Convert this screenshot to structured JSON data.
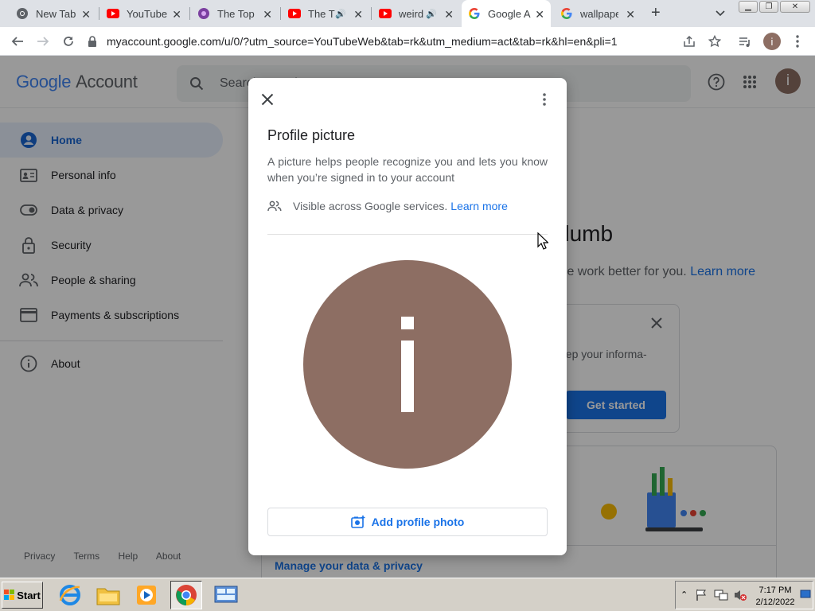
{
  "browser": {
    "tabs": [
      {
        "title": "New Tab",
        "favicon": "chrome-icon"
      },
      {
        "title": "YouTube",
        "favicon": "youtube-icon"
      },
      {
        "title": "The Top",
        "favicon": "flower-icon"
      },
      {
        "title": "The T",
        "favicon": "youtube-icon",
        "audio": true
      },
      {
        "title": "weird",
        "favicon": "youtube-icon",
        "audio": true
      },
      {
        "title": "Google A",
        "favicon": "google-icon",
        "active": true
      },
      {
        "title": "wallpape",
        "favicon": "google-icon"
      }
    ],
    "new_tab_label": "+",
    "url": "myaccount.google.com/u/0/?utm_source=YouTubeWeb&tab=rk&utm_medium=act&tab=rk&hl=en&pli=1",
    "profile_initial": "i"
  },
  "page": {
    "logo_google": "Google",
    "logo_account": "Account",
    "search_placeholder": "Search Google Account",
    "avatar_initial": "i",
    "nav": [
      {
        "label": "Home",
        "icon": "person-circle-icon",
        "selected": true
      },
      {
        "label": "Personal info",
        "icon": "id-card-icon"
      },
      {
        "label": "Data & privacy",
        "icon": "toggle-icon"
      },
      {
        "label": "Security",
        "icon": "lock-icon"
      },
      {
        "label": "People & sharing",
        "icon": "people-icon"
      },
      {
        "label": "Payments & subscriptions",
        "icon": "credit-card-icon"
      }
    ],
    "nav_about": "About",
    "footer": [
      "Privacy",
      "Terms",
      "Help",
      "About"
    ],
    "bg_heading_fragment": "dumb",
    "bg_sub_fragment": "gle work better for you.",
    "bg_sub_link": "Learn more",
    "bg_card_text": "eep your informa-",
    "bg_card_button": "Get started",
    "bg_manage_link": "Manage your data & privacy"
  },
  "dialog": {
    "title": "Profile picture",
    "description": "A picture helps people recognize you and lets you know when you’re signed in to your account",
    "visibility_text": "Visible across Google services.",
    "learn_more": "Learn more",
    "picture_initial": "i",
    "add_button": "Add profile photo"
  },
  "taskbar": {
    "start": "Start",
    "time": "7:17 PM",
    "date": "2/12/2022"
  },
  "colors": {
    "avatar": "#8d6e63",
    "link": "#1a73e8",
    "overlay": "rgba(0,0,0,0.4)"
  }
}
